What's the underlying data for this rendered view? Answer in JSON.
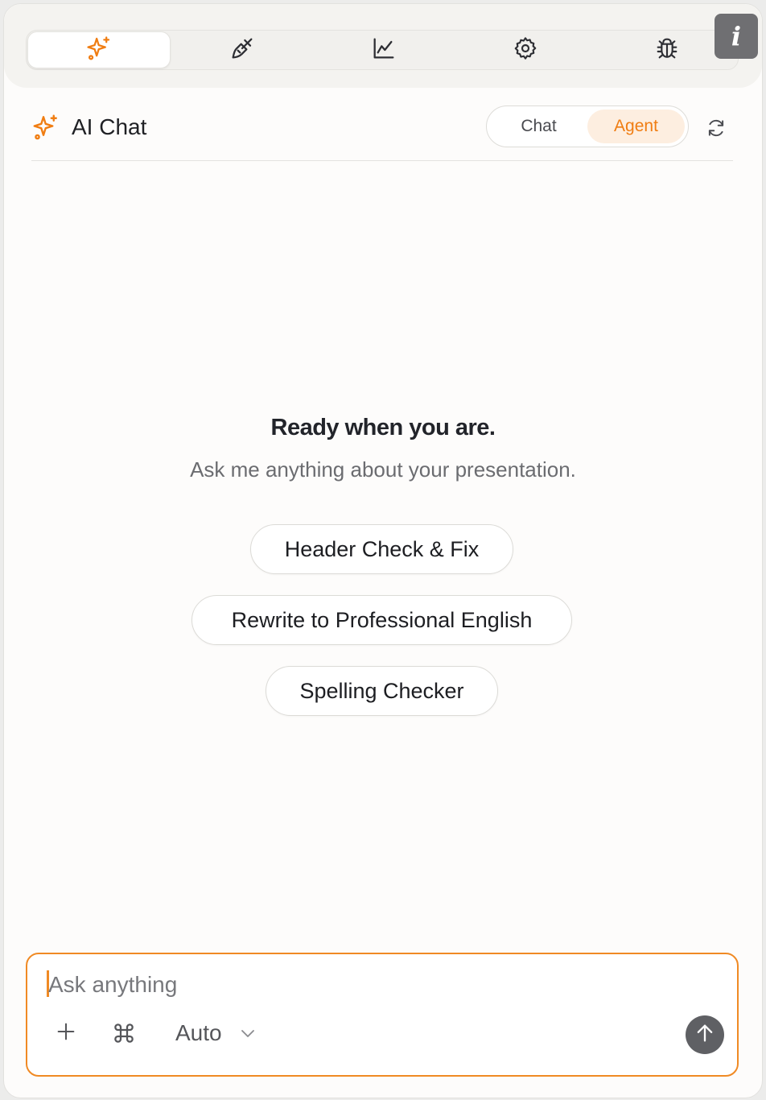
{
  "colors": {
    "accent": "#f07d12",
    "accent_soft": "#fdeee0",
    "icon_dark": "#2d2e33",
    "send_bg": "#5f6064"
  },
  "toolbar": {
    "tabs": [
      {
        "icon": "sparkles-icon",
        "active": true
      },
      {
        "icon": "paintbrush-icon",
        "active": false
      },
      {
        "icon": "line-chart-icon",
        "active": false
      },
      {
        "icon": "gear-icon",
        "active": false
      },
      {
        "icon": "bug-icon",
        "active": false
      }
    ],
    "info_label": "i"
  },
  "header": {
    "title": "AI Chat",
    "modes": [
      "Chat",
      "Agent"
    ],
    "active_mode": "Agent"
  },
  "empty_state": {
    "title": "Ready when you are.",
    "subtitle": "Ask me anything about your presentation."
  },
  "suggestions": [
    "Header Check & Fix",
    "Rewrite to Professional English",
    "Spelling Checker"
  ],
  "composer": {
    "placeholder": "Ask anything",
    "value": "",
    "model_select": "Auto"
  }
}
